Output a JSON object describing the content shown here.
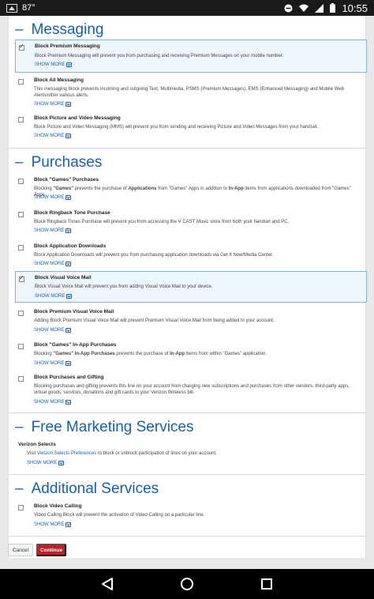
{
  "status_bar": {
    "temperature": "87°",
    "time": "10:55"
  },
  "sections": {
    "messaging": {
      "title": "Messaging"
    },
    "purchases": {
      "title": "Purchases"
    },
    "marketing": {
      "title": "Free Marketing Services"
    },
    "additional": {
      "title": "Additional Services"
    }
  },
  "show_more_label": "SHOW MORE",
  "items": {
    "premium_messaging": {
      "title": "Block Premium Messaging",
      "desc": "Block Premium Messaging will prevent you from purchasing and receiving Premium Messages on your mobile number.",
      "checked": true
    },
    "all_messaging": {
      "title": "Block All Messaging",
      "desc": "This messaging block prevents incoming and outgoing Text, Multimedia, PSMS (Premium Messages), EMS (Enhanced Messaging) and Mobile Web Alerts/other various alerts.",
      "checked": false
    },
    "picture_video": {
      "title": "Block Picture and Video Messaging",
      "desc": "Block Picture and Video Messaging (MMS) will prevent you from sending and receiving Picture and Video Messages from your handset.",
      "checked": false
    },
    "games_purchases": {
      "title": "Block \"Games\" Purchases",
      "desc_pre": "Blocking ",
      "desc_b1": "\"Games\"",
      "desc_mid1": " prevents the purchase of ",
      "desc_b2": "Applications",
      "desc_mid2": " from \"Games\" Apps in addition to ",
      "desc_b3": "In-App",
      "desc_post": " items from applications downloaded from \"Games\" Apps.",
      "checked": false
    },
    "ringback": {
      "title": "Block Ringback Tone Purchase",
      "desc": "Block Ringback Tones Purchase will prevent you from accessing the V CAST Music store from both your handset and PC.",
      "checked": false
    },
    "app_downloads": {
      "title": "Block Application Downloads",
      "desc": "Block Application Downloads will prevent you from purchasing application downloads via Get It Now/Media Center.",
      "checked": false
    },
    "visual_voicemail": {
      "title": "Block Visual Voice Mail",
      "desc": "Block Visual Voice Mail will prevent you from adding Visual Voice Mail to your device.",
      "checked": true
    },
    "premium_vvm": {
      "title": "Block Premium Visual Voice Mail",
      "desc": "Adding Block Premium Visual Voice Mail will prevent Premium Visual Voice Mail from being added to your account.",
      "checked": false
    },
    "games_inapp": {
      "title": "Block \"Games\" In-App Purchases",
      "desc_pre": "Blocking ",
      "desc_b1": "\"Games\" In-App Purchases",
      "desc_mid1": " prevents the purchase of ",
      "desc_b2": "In-App",
      "desc_post": " items from within \"Games\" application.",
      "checked": false
    },
    "purchases_gifting": {
      "title": "Block Purchases and Gifting",
      "desc": "Blocking purchases and gifting prevents this line on your account from charging new subscriptions and purchases from other vendors, third-party apps, virtual goods, services, donations and gift cards to your Verizon Wireless bill.",
      "checked": false
    },
    "video_calling": {
      "title": "Block Video Calling",
      "desc": "Video Calling Block will prevent the activation of Video Calling on a particular line.",
      "checked": false
    }
  },
  "verizon_selects": {
    "title": "Verizon Selects",
    "visit": "Visit ",
    "link": "Verizon Selects Preferences",
    "post": " to block or unblock participation of lines on your account."
  },
  "footer": {
    "cancel": "Cancel",
    "continue": "Continue"
  }
}
